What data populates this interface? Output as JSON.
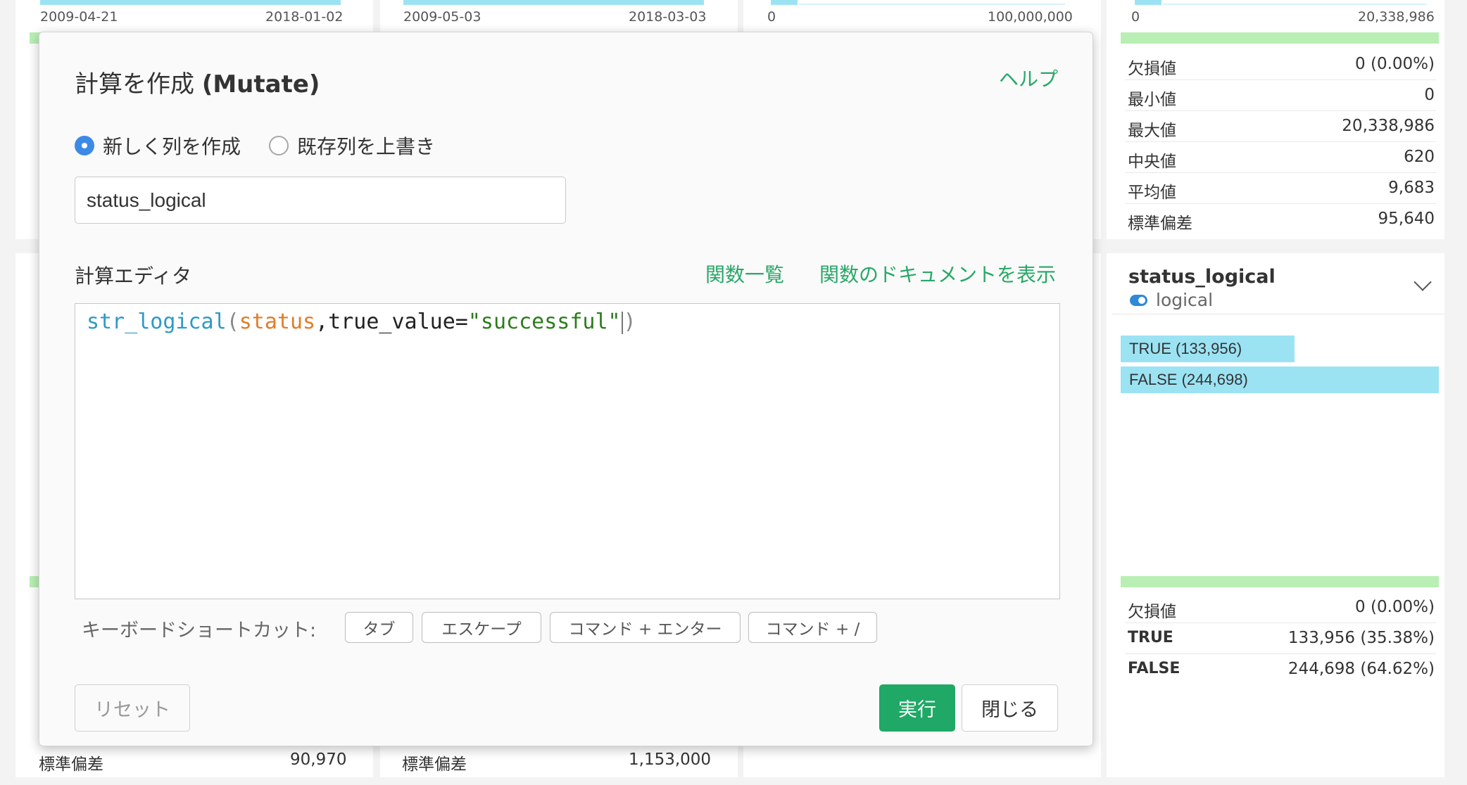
{
  "background": {
    "cards": [
      {
        "axis_min": "2009-04-21",
        "axis_max": "2018-01-02",
        "bottom_label": "標準偏差",
        "bottom_value": "90,970"
      },
      {
        "axis_min": "2009-05-03",
        "axis_max": "2018-03-03",
        "bottom_label": "標準偏差",
        "bottom_value": "1,153,000"
      },
      {
        "axis_min": "0",
        "axis_max": "100,000,000"
      },
      {
        "axis_min": "0",
        "axis_max": "20,338,986"
      }
    ],
    "right_stats_top": [
      {
        "label": "欠損値",
        "value": "0 (0.00%)"
      },
      {
        "label": "最小値",
        "value": "0"
      },
      {
        "label": "最大値",
        "value": "20,338,986"
      },
      {
        "label": "中央値",
        "value": "620"
      },
      {
        "label": "平均値",
        "value": "9,683"
      },
      {
        "label": "標準偏差",
        "value": "95,640"
      }
    ],
    "column_card": {
      "title": "status_logical",
      "type": "logical",
      "bars": [
        {
          "label": "TRUE (133,956)",
          "fraction": 0.547
        },
        {
          "label": "FALSE (244,698)",
          "fraction": 1.0
        }
      ],
      "stats": [
        {
          "label": "欠損値",
          "value": "0 (0.00%)"
        },
        {
          "label": "TRUE",
          "value": "133,956 (35.38%)"
        },
        {
          "label": "FALSE",
          "value": "244,698 (64.62%)"
        }
      ]
    }
  },
  "modal": {
    "title_ja": "計算を作成",
    "title_en": "(Mutate)",
    "help_link": "ヘルプ",
    "radio_new": "新しく列を作成",
    "radio_overwrite": "既存列を上書き",
    "column_name_value": "status_logical",
    "editor_label": "計算エディタ",
    "functions_link": "関数一覧",
    "docs_link": "関数のドキュメントを表示",
    "code": {
      "fn": "str_logical",
      "open": "(",
      "arg": "status",
      "sep": ",true_value=",
      "str": "\"successful\"",
      "close": ")"
    },
    "shortcut_label": "キーボードショートカット:",
    "shortcuts": [
      "タブ",
      "エスケープ",
      "コマンド + エンター",
      "コマンド + /"
    ],
    "reset_button": "リセット",
    "run_button": "実行",
    "close_button": "閉じる"
  },
  "colors": {
    "accent_green": "#1fa866",
    "link_green": "#27a867",
    "radio_blue": "#3d8ae6",
    "histogram_cyan": "#9be3f3",
    "quality_green": "#b9efb4"
  }
}
